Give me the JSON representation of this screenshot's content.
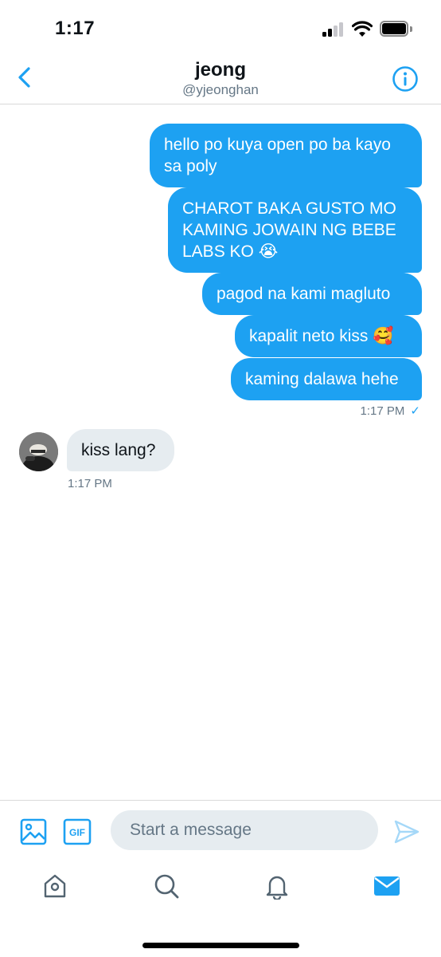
{
  "status_bar": {
    "time": "1:17"
  },
  "header": {
    "name": "jeong",
    "handle": "@yjeonghan"
  },
  "messages_out": [
    {
      "text": "hello po kuya open po ba kayo sa poly"
    },
    {
      "text": "CHAROT BAKA GUSTO MO KAMING JOWAIN NG BEBE LABS KO 😭"
    },
    {
      "text": "pagod na kami magluto"
    },
    {
      "text": "kapalit neto kiss 🥰"
    },
    {
      "text": "kaming dalawa hehe"
    }
  ],
  "out_timestamp": "1:17 PM",
  "out_read_mark": "✓",
  "message_in": {
    "text": "kiss lang?",
    "timestamp": "1:17 PM"
  },
  "composer": {
    "placeholder": "Start a message",
    "gif_label": "GIF"
  },
  "colors": {
    "accent": "#1da1f2",
    "incoming_bubble": "#e6ecf0",
    "meta_text": "#657786"
  },
  "icons": {
    "back": "chevron-left-icon",
    "info": "info-icon",
    "media": "image-icon",
    "gif": "gif-icon",
    "send": "send-icon",
    "tabs": [
      "home-icon",
      "search-icon",
      "bell-icon",
      "mail-icon"
    ]
  }
}
